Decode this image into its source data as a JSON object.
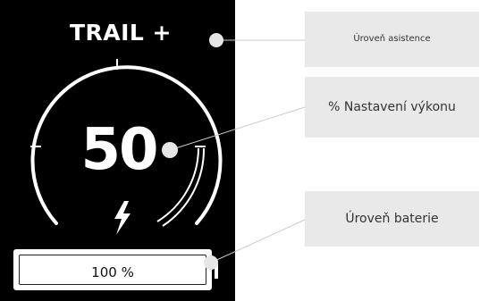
{
  "display": {
    "mode": "TRAIL +",
    "power_percent": "50",
    "battery_text": "100 %",
    "battery_level": 1.0,
    "power_level": 0.5
  },
  "callouts": {
    "assist_level": "Úroveň asistence",
    "power_setting": "% Nastavení výkonu",
    "battery_level": "Úroveň baterie"
  },
  "icons": {
    "charge": "lightning-bolt-icon"
  },
  "colors": {
    "screen_bg": "#000000",
    "screen_fg": "#ffffff",
    "callout_bg": "#e9e9e9",
    "leader_line": "#cccccc"
  }
}
